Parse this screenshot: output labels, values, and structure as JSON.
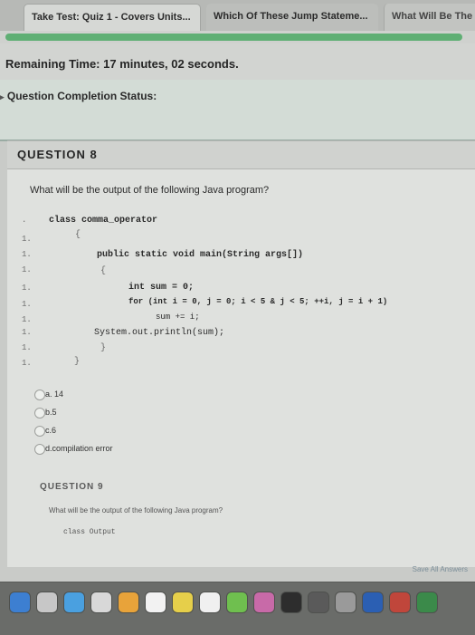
{
  "tabs": [
    {
      "label": "Take Test: Quiz 1 - Covers Units..."
    },
    {
      "label": "Which Of These Jump Stateme..."
    },
    {
      "label": "What Will Be The O"
    }
  ],
  "remaining_time": {
    "label": "Remaining Time:",
    "value": "17 minutes, 02 seconds."
  },
  "completion_status": {
    "label": "Question Completion Status:"
  },
  "question8": {
    "header": "QUESTION 8",
    "text": "What will be the output of the following Java program?",
    "code": {
      "line1": "class comma_operator",
      "line2": "{",
      "line3": "public static void main(String args[])",
      "line4": "{",
      "line5": "int sum = 0;",
      "line6": "for (int i = 0, j = 0; i < 5 & j < 5; ++i, j = i + 1)",
      "line7": "sum += i;",
      "line8": "System.out.println(sum);",
      "line9": "}",
      "line10": "}"
    },
    "gutter": [
      ".",
      "1.",
      "1.",
      "1.",
      "1.",
      "1.",
      "1.",
      "1.",
      "1.",
      "1."
    ],
    "options": [
      {
        "label": "a. 14"
      },
      {
        "label": "b.5"
      },
      {
        "label": "c.6"
      },
      {
        "label": "d.compilation error"
      }
    ]
  },
  "question9": {
    "header": "QUESTION 9",
    "text": "What will be the output of the following Java program?",
    "code": "class Output"
  },
  "save_all": "Save All Answers",
  "colors": {
    "progress": "#5faf74",
    "background": "#c9cbc8"
  },
  "progress_fraction": 0.985
}
